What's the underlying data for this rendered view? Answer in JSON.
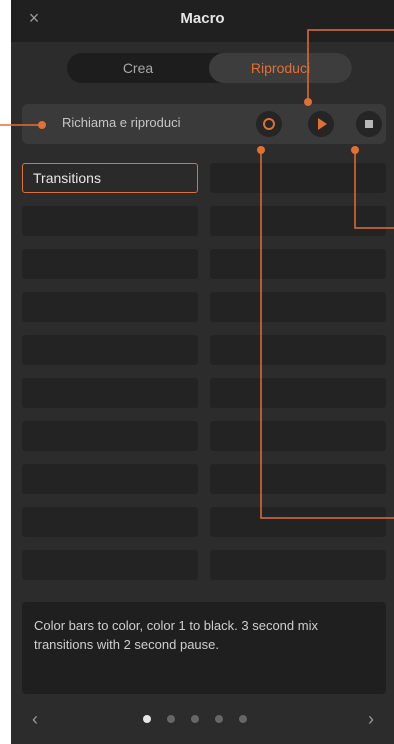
{
  "window": {
    "title": "Macro",
    "close_glyph": "×"
  },
  "tabs": [
    {
      "label": "Crea",
      "selected": false
    },
    {
      "label": "Riproduci",
      "selected": true
    }
  ],
  "macro_row": {
    "label": "Richiama e riproduci",
    "buttons": [
      {
        "name": "record",
        "icon": "record-icon"
      },
      {
        "name": "play",
        "icon": "play-icon"
      },
      {
        "name": "stop",
        "icon": "stop-icon"
      }
    ]
  },
  "macros": {
    "selected_label": "Transitions",
    "rows": 10,
    "columns": 2
  },
  "description": "Color bars to color, color 1 to black. 3 second mix transitions with 2 second pause.",
  "pager": {
    "left_glyph": "‹",
    "right_glyph": "›",
    "pages": 5,
    "active": 1
  },
  "colors": {
    "accent": "#e07033",
    "panel": "#2c2c2c",
    "cell": "#232323"
  }
}
